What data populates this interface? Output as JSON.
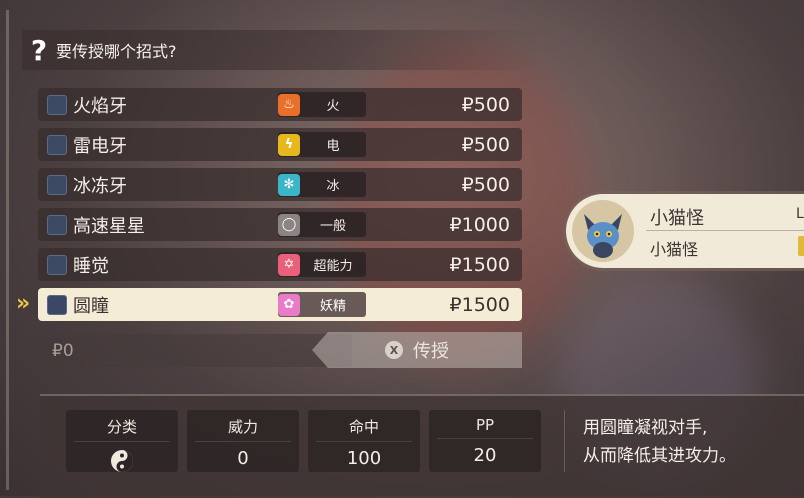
{
  "header": {
    "icon": "question-icon",
    "text": "要传授哪个招式?"
  },
  "moves": [
    {
      "name": "火焰牙",
      "type": "火",
      "type_color": "#e8702a",
      "type_glyph": "♨",
      "price": "₽500",
      "selected": false
    },
    {
      "name": "雷电牙",
      "type": "电",
      "type_color": "#e6b81e",
      "type_glyph": "ϟ",
      "price": "₽500",
      "selected": false
    },
    {
      "name": "冰冻牙",
      "type": "冰",
      "type_color": "#3bb6c8",
      "type_glyph": "✻",
      "price": "₽500",
      "selected": false
    },
    {
      "name": "高速星星",
      "type": "一般",
      "type_color": "#8a8583",
      "type_glyph": "◯",
      "price": "₽1000",
      "selected": false
    },
    {
      "name": "睡觉",
      "type": "超能力",
      "type_color": "#e8607a",
      "type_glyph": "✡",
      "price": "₽1500",
      "selected": false
    },
    {
      "name": "圆瞳",
      "type": "妖精",
      "type_color": "#e87cc8",
      "type_glyph": "✿",
      "price": "₽1500",
      "selected": true
    }
  ],
  "money": "₽0",
  "teach_button": {
    "label": "传授",
    "key": "X"
  },
  "stats": [
    {
      "label": "分类",
      "value": ""
    },
    {
      "label": "威力",
      "value": "0"
    },
    {
      "label": "命中",
      "value": "100"
    },
    {
      "label": "PP",
      "value": "20"
    }
  ],
  "description": [
    "用圆瞳凝视对手,",
    "从而降低其进攻力。"
  ],
  "pokemon_card": {
    "name": "小猫怪",
    "species": "小猫怪",
    "level_prefix": "L"
  }
}
